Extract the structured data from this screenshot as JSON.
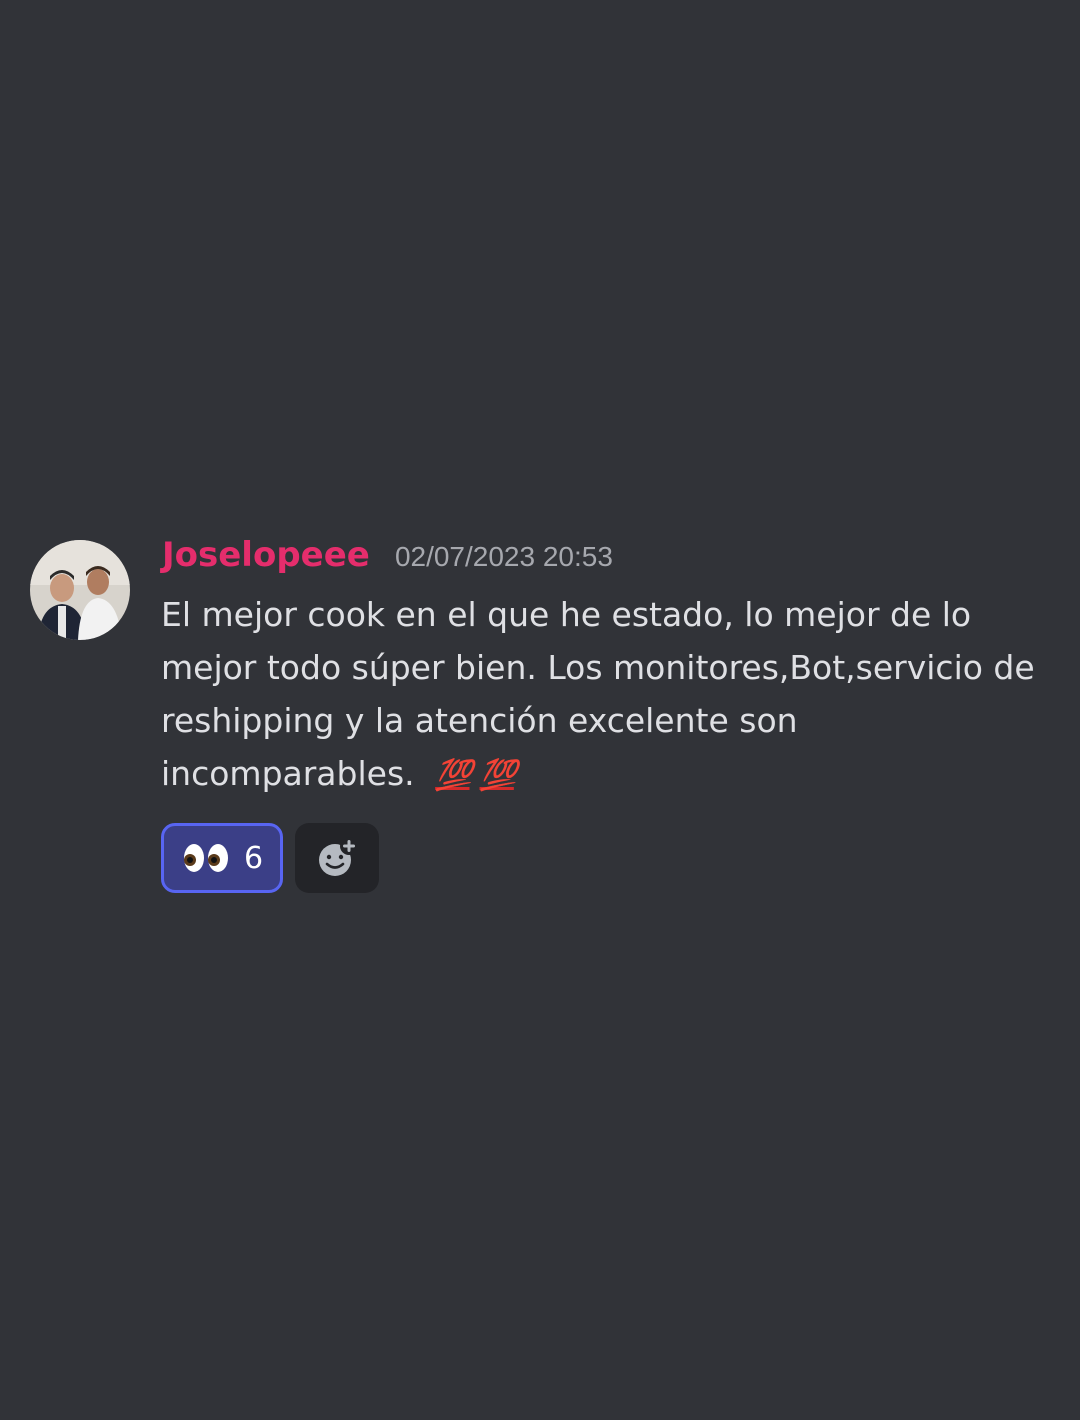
{
  "message": {
    "username": "Joselopeee",
    "timestamp": "02/07/2023 20:53",
    "avatar_icon": "user-avatar-photo",
    "text": "El mejor cook en el que he estado, lo mejor de lo mejor todo súper bien. Los monitores,Bot,servicio de reshipping y la atención excelente son incomparables.",
    "emojis": [
      "💯",
      "💯"
    ],
    "username_color": "#e52d6c"
  },
  "reactions": [
    {
      "emoji_icon": "eyes-emoji-icon",
      "count": "6",
      "selected": true
    }
  ],
  "add_reaction": {
    "icon": "add-reaction-icon"
  }
}
